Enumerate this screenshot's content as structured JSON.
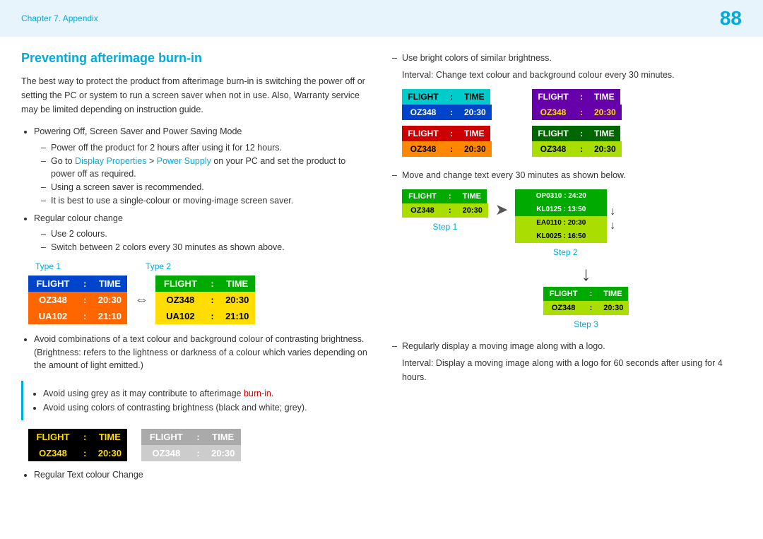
{
  "header": {
    "chapter": "Chapter 7. Appendix",
    "page_number": "88"
  },
  "section": {
    "title": "Preventing afterimage burn-in",
    "intro": "The best way to protect the product from afterimage burn-in is switching the power off or setting the PC or system to run a screen saver when not in use. Also, Warranty service may be limited depending on instruction guide."
  },
  "left_column": {
    "bullet1": {
      "text": "Powering Off, Screen Saver and Power Saving Mode",
      "sub_items": [
        "Power off the product for 2 hours after using it for 12 hours.",
        "Go to {link1}Display Properties{/link1} > {link2}Power Supply{/link2} on your PC and set the product to power off as required.",
        "Using a screen saver is recommended.",
        "It is best to use a single-colour or moving-image screen saver."
      ]
    },
    "bullet2": {
      "text": "Regular colour change",
      "sub_items": [
        "Use 2 colours.",
        "Switch between 2 colors every 30 minutes as shown above."
      ]
    },
    "type1_label": "Type 1",
    "type2_label": "Type 2",
    "board_type1": {
      "rows": [
        [
          {
            "text": "FLIGHT",
            "bg": "blue"
          },
          {
            "text": ":",
            "bg": "blue"
          },
          {
            "text": "TIME",
            "bg": "blue"
          }
        ],
        [
          {
            "text": "OZ348",
            "bg": "orange"
          },
          {
            "text": ":",
            "bg": "orange"
          },
          {
            "text": "20:30",
            "bg": "orange"
          }
        ],
        [
          {
            "text": "UA102",
            "bg": "orange"
          },
          {
            "text": ":",
            "bg": "orange"
          },
          {
            "text": "21:10",
            "bg": "orange"
          }
        ]
      ]
    },
    "board_type2": {
      "rows": [
        [
          {
            "text": "FLIGHT",
            "bg": "green"
          },
          {
            "text": ":",
            "bg": "green"
          },
          {
            "text": "TIME",
            "bg": "green"
          }
        ],
        [
          {
            "text": "OZ348",
            "bg": "yellow"
          },
          {
            "text": ":",
            "bg": "yellow"
          },
          {
            "text": "20:30",
            "bg": "yellow"
          }
        ],
        [
          {
            "text": "UA102",
            "bg": "yellow"
          },
          {
            "text": ":",
            "bg": "yellow"
          },
          {
            "text": "21:10",
            "bg": "yellow"
          }
        ]
      ]
    },
    "bullet3": {
      "text": "Avoid combinations of a text colour and background colour of contrasting brightness. (Brightness: refers to the lightness or darkness of a colour which varies depending on the amount of light emitted.)"
    },
    "warning_items": [
      "Avoid using grey as it may contribute to afterimage burn-in.",
      "Avoid using colors of contrasting brightness (black and white; grey)."
    ],
    "contrast_board1": {
      "rows": [
        [
          {
            "text": "FLIGHT",
            "bg": "black"
          },
          {
            "text": ":",
            "bg": "black"
          },
          {
            "text": "TIME",
            "bg": "black"
          }
        ],
        [
          {
            "text": "OZ348",
            "bg": "black"
          },
          {
            "text": ":",
            "bg": "black"
          },
          {
            "text": "20:30",
            "bg": "black"
          }
        ]
      ],
      "label_color": "#ffdd00"
    },
    "contrast_board2": {
      "rows": [
        [
          {
            "text": "FLIGHT",
            "bg": "lightgray"
          },
          {
            "text": ":",
            "bg": "lightgray"
          },
          {
            "text": "TIME",
            "bg": "lightgray"
          }
        ],
        [
          {
            "text": "OZ348",
            "bg": "lightgray"
          },
          {
            "text": ":",
            "bg": "lightgray"
          },
          {
            "text": "20:30",
            "bg": "lightgray"
          }
        ]
      ]
    },
    "bullet4": "Regular Text colour Change"
  },
  "right_column": {
    "bullet1": "Use bright colors of similar brightness.",
    "bullet1_sub": "Interval: Change text colour and background colour every 30 minutes.",
    "color_boards": [
      {
        "header_bg": "cyan",
        "header_text_color": "#000",
        "row_bg": "blue",
        "row_text_color": "#fff",
        "header": "FLIGHT   :   TIME",
        "row": "OZ348   :   20:30"
      },
      {
        "header_bg": "purple",
        "header_text_color": "#fff",
        "row_bg": "purple",
        "row_text_color": "#ffdd00",
        "header": "FLIGHT   :   TIME",
        "row": "OZ348   :   20:30"
      },
      {
        "header_bg": "red",
        "header_text_color": "#fff",
        "row_bg": "orange2",
        "row_text_color": "#000",
        "header": "FLIGHT   :   TIME",
        "row": "OZ348   :   20:30"
      },
      {
        "header_bg": "darkgreen2",
        "header_text_color": "#fff",
        "row_bg": "lime2",
        "row_text_color": "#000",
        "header": "FLIGHT   :   TIME",
        "row": "OZ348   :   20:30"
      }
    ],
    "bullet2": "Move and change text every 30 minutes as shown below.",
    "step1_label": "Step 1",
    "step2_label": "Step 2",
    "step3_label": "Step 3",
    "step1_board": {
      "header": "FLIGHT   :   TIME",
      "row": "OZ348   :   20:30"
    },
    "step2_board": {
      "rows": [
        "OP0310  :  24:20",
        "KL0125  :  13:50",
        "EA0110  :  20:30",
        "KL0025  :  16:50"
      ]
    },
    "step3_board": {
      "header": "FLIGHT   :   TIME",
      "row": "OZ348   :   20:30"
    },
    "bullet3": "Regularly display a moving image along with a logo.",
    "bullet3_sub": "Interval: Display a moving image along with a logo for 60 seconds after using for 4 hours."
  }
}
